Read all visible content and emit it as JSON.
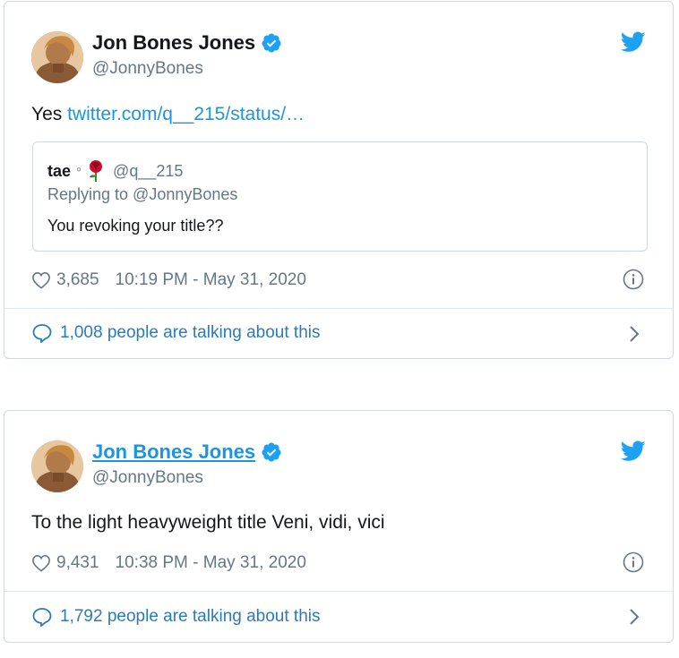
{
  "tweets": [
    {
      "author_name": "Jon Bones Jones",
      "handle": "@JonnyBones",
      "text_prefix": "Yes ",
      "link_text": "twitter.com/q__215/status/…",
      "quote": {
        "name": "tae",
        "handle": "@q__215",
        "replying_to": "Replying to @JonnyBones",
        "text": "You revoking your title??"
      },
      "likes": "3,685",
      "timestamp": "10:19 PM - May 31, 2020",
      "talking": "1,008 people are talking about this"
    },
    {
      "author_name": "Jon Bones Jones",
      "handle": "@JonnyBones",
      "text": "To the light heavyweight title Veni, vidi, vici",
      "likes": "9,431",
      "timestamp": "10:38 PM - May 31, 2020",
      "talking": "1,792 people are talking about this"
    }
  ],
  "icons": {
    "twitter": "twitter-bird-icon",
    "verified": "verified-badge-icon",
    "heart": "heart-icon",
    "info": "info-icon",
    "bubble": "speech-bubble-icon",
    "chevron": "chevron-right-icon"
  },
  "colors": {
    "brand_blue": "#1da1f2",
    "link_blue": "#1b95e0",
    "talk_blue": "#2b7bb9",
    "muted": "#657786"
  }
}
